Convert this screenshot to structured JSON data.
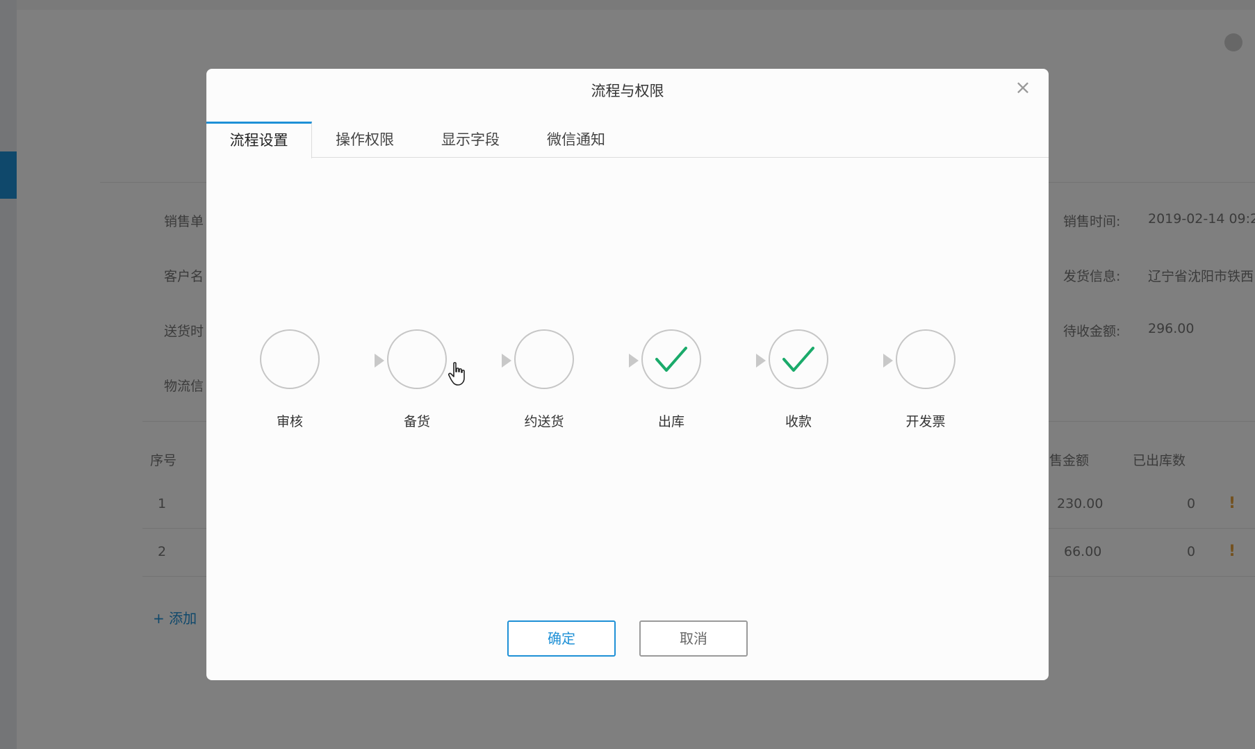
{
  "background": {
    "fields_left": [
      "销售单",
      "客户名",
      "送货时",
      "物流信"
    ],
    "fields_right": [
      {
        "label": "销售时间:",
        "value": "2019-02-14 09:2"
      },
      {
        "label": "发货信息:",
        "value": "辽宁省沈阳市铁西"
      },
      {
        "label": "待收金额:",
        "value": "296.00"
      }
    ],
    "table": {
      "headers": [
        "序号",
        "售金额",
        "已出库数"
      ],
      "rows": [
        {
          "index": "1",
          "amount": "230.00",
          "shipped": "0",
          "warn": "!"
        },
        {
          "index": "2",
          "amount": "66.00",
          "shipped": "0",
          "warn": "!"
        }
      ]
    },
    "add_link": "+ 添加"
  },
  "modal": {
    "title": "流程与权限",
    "close_icon": "close-icon",
    "tabs": [
      {
        "label": "流程设置",
        "active": true
      },
      {
        "label": "操作权限",
        "active": false
      },
      {
        "label": "显示字段",
        "active": false
      },
      {
        "label": "微信通知",
        "active": false
      }
    ],
    "steps": [
      {
        "label": "审核",
        "checked": false
      },
      {
        "label": "备货",
        "checked": false
      },
      {
        "label": "约送货",
        "checked": false
      },
      {
        "label": "出库",
        "checked": true
      },
      {
        "label": "收款",
        "checked": true
      },
      {
        "label": "开发票",
        "checked": false
      }
    ],
    "check_color": "#1aaa6a",
    "accent_color": "#1e90d6",
    "buttons": {
      "ok": "确定",
      "cancel": "取消"
    }
  }
}
